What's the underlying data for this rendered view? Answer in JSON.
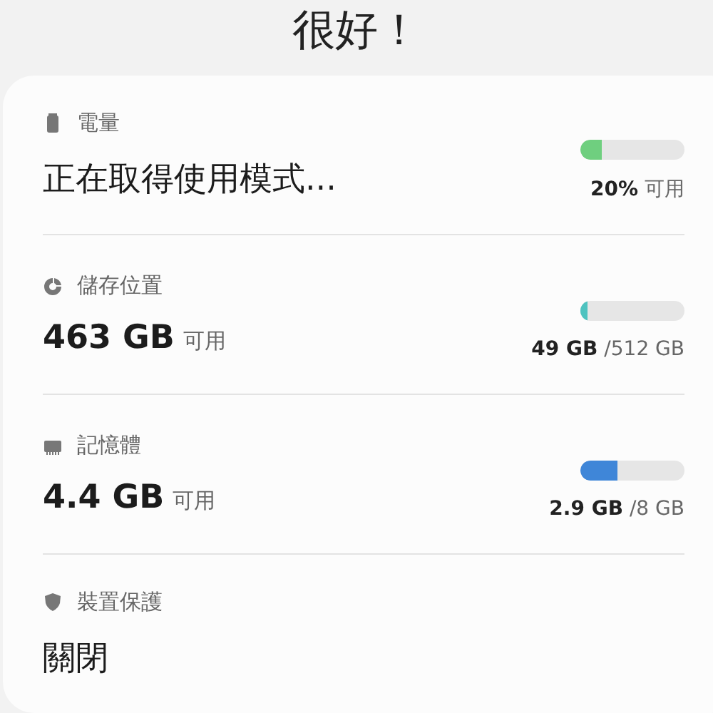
{
  "title": "很好！",
  "items": [
    {
      "kind": "battery",
      "label": "電量",
      "value": "正在取得使用模式...",
      "level": 0.2,
      "color": "#6fcf7f",
      "reading_main": "20%",
      "reading_rest": "可用"
    },
    {
      "kind": "storage",
      "label": "儲存位置",
      "value": "463 GB",
      "value_suffix": "可用",
      "level": 0.07,
      "color": "#4ec3c0",
      "reading_main": "49 GB",
      "reading_rest": "/512 GB"
    },
    {
      "kind": "memory",
      "label": "記憶體",
      "value": "4.4 GB",
      "value_suffix": "可用",
      "level": 0.36,
      "color": "#3f86d8",
      "reading_main": "2.9 GB",
      "reading_rest": "/8 GB"
    },
    {
      "kind": "protection",
      "label": "裝置保護",
      "value": "關閉"
    }
  ]
}
